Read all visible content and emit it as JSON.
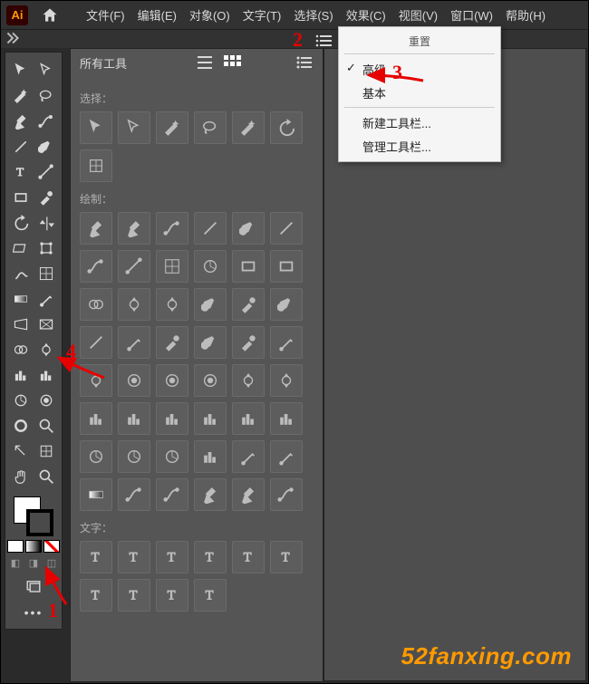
{
  "app": {
    "badge": "Ai"
  },
  "menubar": [
    {
      "label": "文件(F)"
    },
    {
      "label": "编辑(E)"
    },
    {
      "label": "对象(O)"
    },
    {
      "label": "文字(T)"
    },
    {
      "label": "选择(S)"
    },
    {
      "label": "效果(C)"
    },
    {
      "label": "视图(V)"
    },
    {
      "label": "窗口(W)"
    },
    {
      "label": "帮助(H)"
    }
  ],
  "all_tools": {
    "title": "所有工具",
    "sections": {
      "select": "选择：",
      "draw": "绘制：",
      "type": "文字："
    }
  },
  "dropdown": {
    "header": "重置",
    "advanced": "高级",
    "basic": "基本",
    "new_toolbar": "新建工具栏...",
    "manage_toolbar": "管理工具栏..."
  },
  "annotations": {
    "n1": "1",
    "n2": "2",
    "n3": "3",
    "n4": "4"
  },
  "watermark": "52fanxing.com",
  "toolbox_rows": 16,
  "select_tool_count": 6,
  "crop_tool_count": 1,
  "draw_tool_count": 48,
  "type_tool_count": 10
}
